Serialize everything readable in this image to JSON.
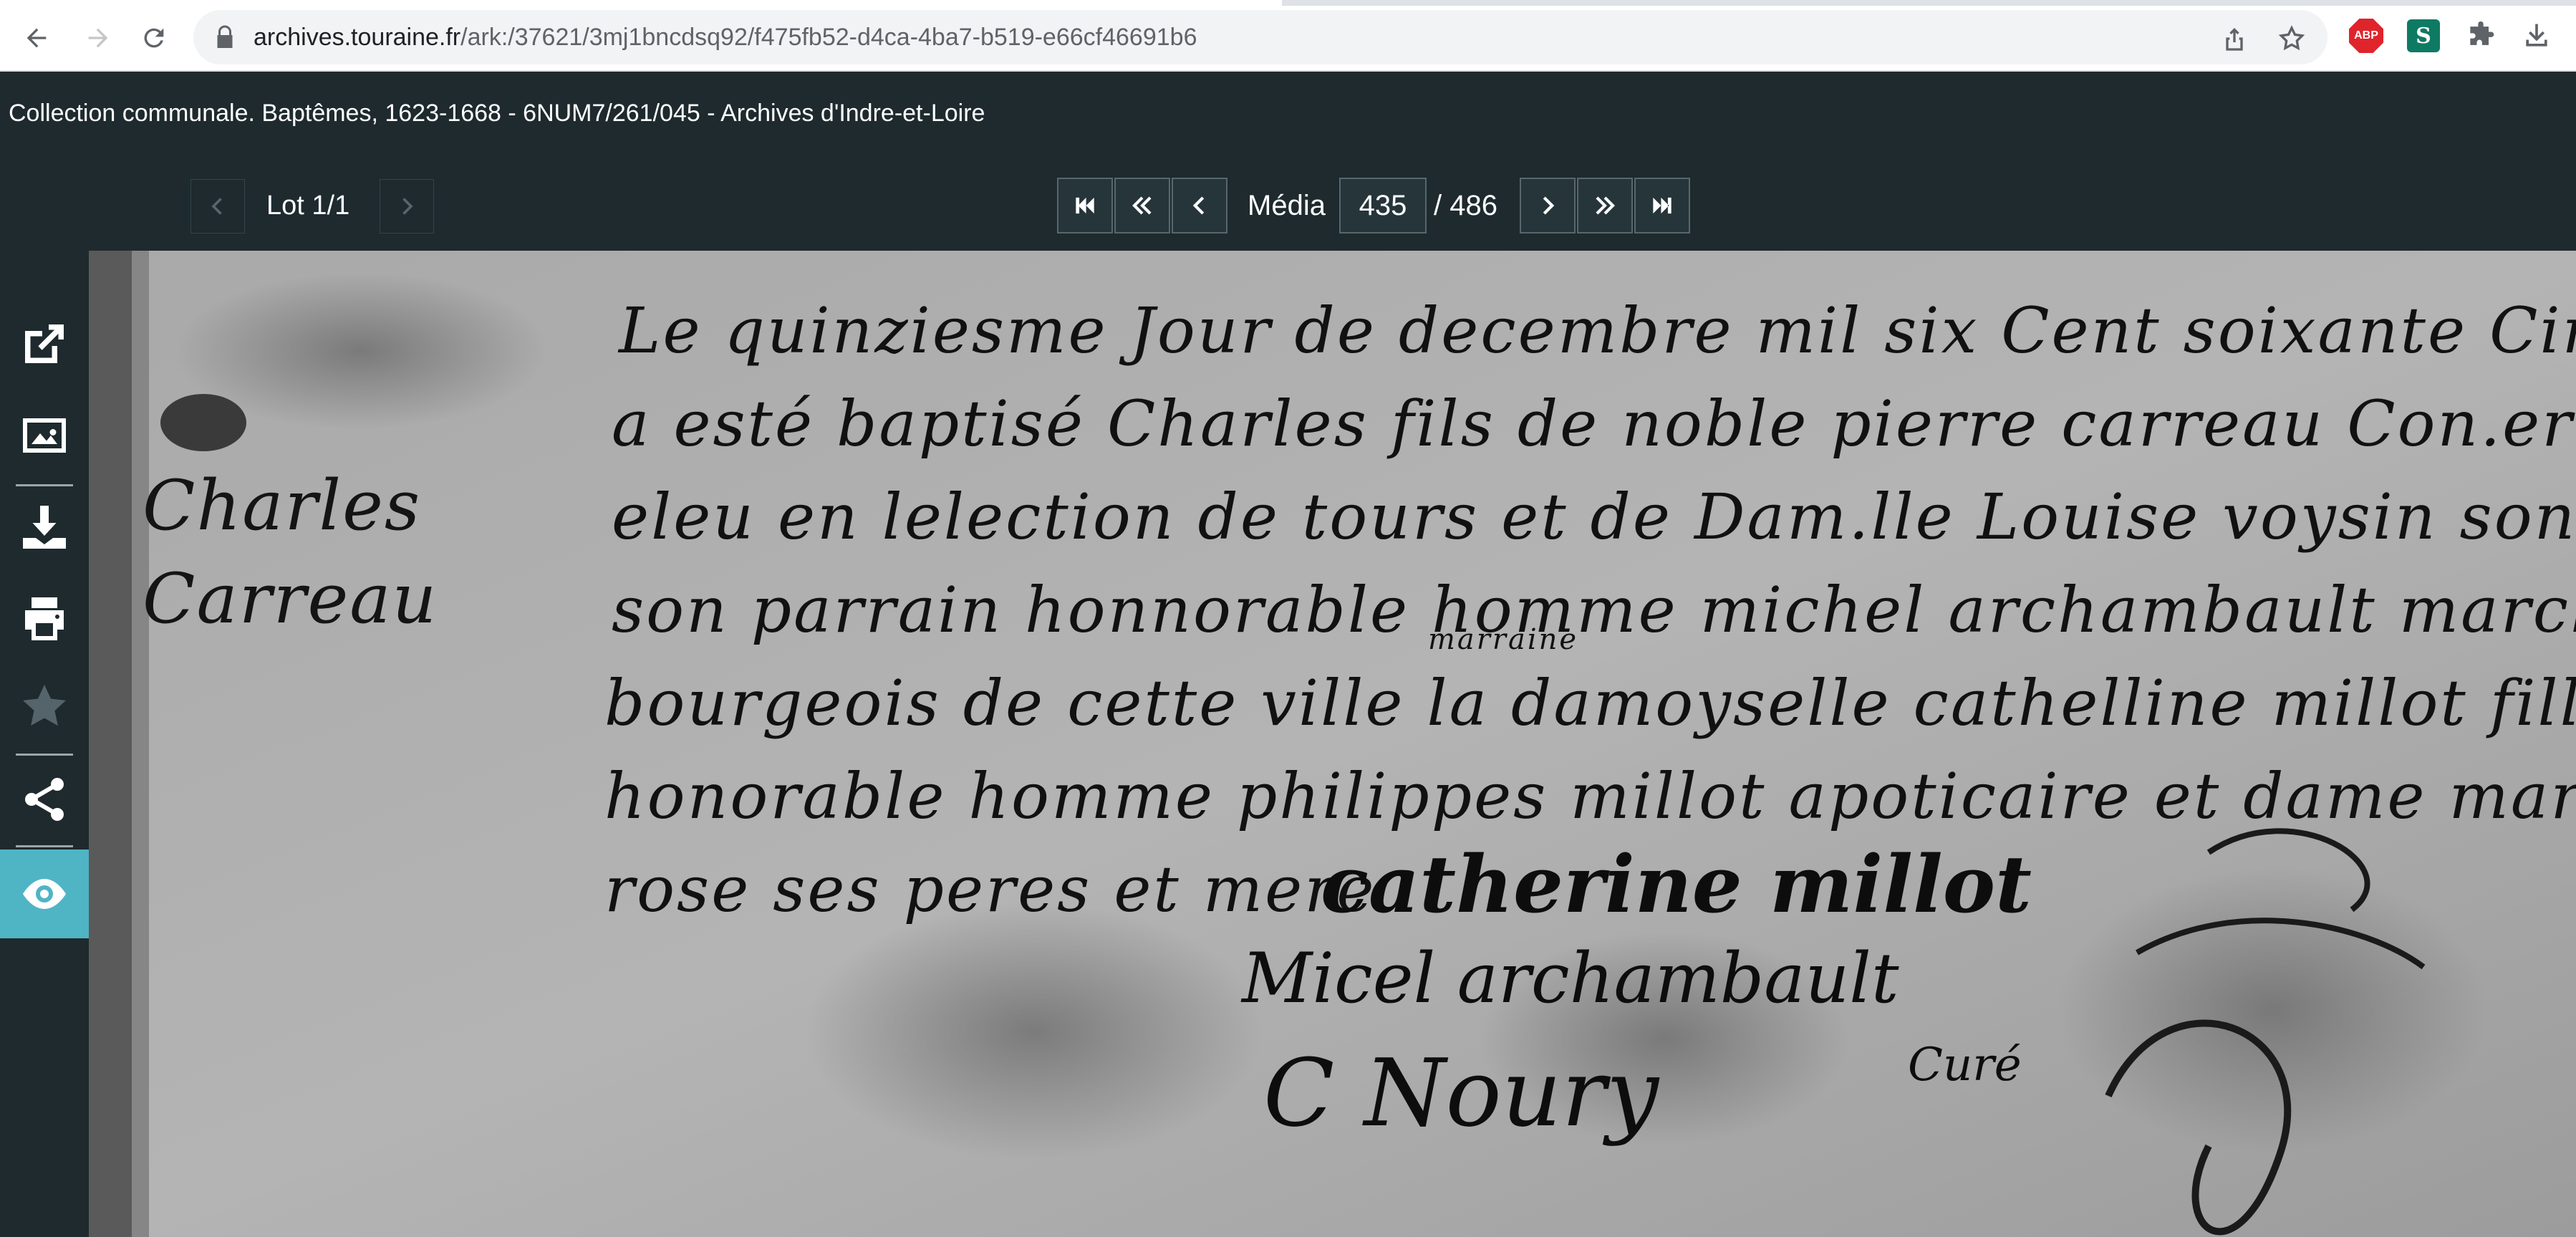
{
  "browser": {
    "url_host": "archives.touraine.fr",
    "url_path": "/ark:/37621/3mj1bncdsq92/f475fb52-d4ca-4ba7-b519-e66cf46691b6",
    "extensions": {
      "abp_label": "ABP",
      "s_label": "S"
    },
    "icons": [
      "back-icon",
      "forward-icon",
      "reload-icon",
      "lock-icon",
      "share-icon",
      "star-icon",
      "puzzle-icon",
      "download-icon"
    ]
  },
  "viewer": {
    "title": "Collection communale. Baptêmes, 1623-1668 - 6NUM7/261/045 - Archives d'Indre-et-Loire",
    "lot": {
      "label": "Lot 1/1"
    },
    "media": {
      "label": "Média",
      "current": "435",
      "total": "/ 486"
    },
    "colors": {
      "background": "#1e2a2e",
      "active_tool": "#4fb4c4"
    },
    "side_tools": [
      "external-link-icon",
      "image-icon",
      "download-icon",
      "print-icon",
      "star-icon",
      "share-icon",
      "eye-icon"
    ]
  },
  "document": {
    "margin_note": [
      "Charles",
      "Carreau"
    ],
    "lines": [
      "Le quinziesme Jour de decembre mil six Cent soixante Cinq",
      "a esté baptisé Charles fils de noble pierre carreau Con.er du roy et",
      "eleu en lelection de tours et de Dam.lle Louise voysin son espouse",
      "son parrain honnorable homme michel archambault marchand",
      "bourgeois de cette ville la damoyselle cathelline millot fille de",
      "honorable homme philippes millot apoticaire et dame marie",
      "rose ses peres et mere"
    ],
    "interline_note": "marraine",
    "signatures": [
      "catherine millot",
      "Micel archambault",
      "C Noury",
      "Curé"
    ]
  }
}
